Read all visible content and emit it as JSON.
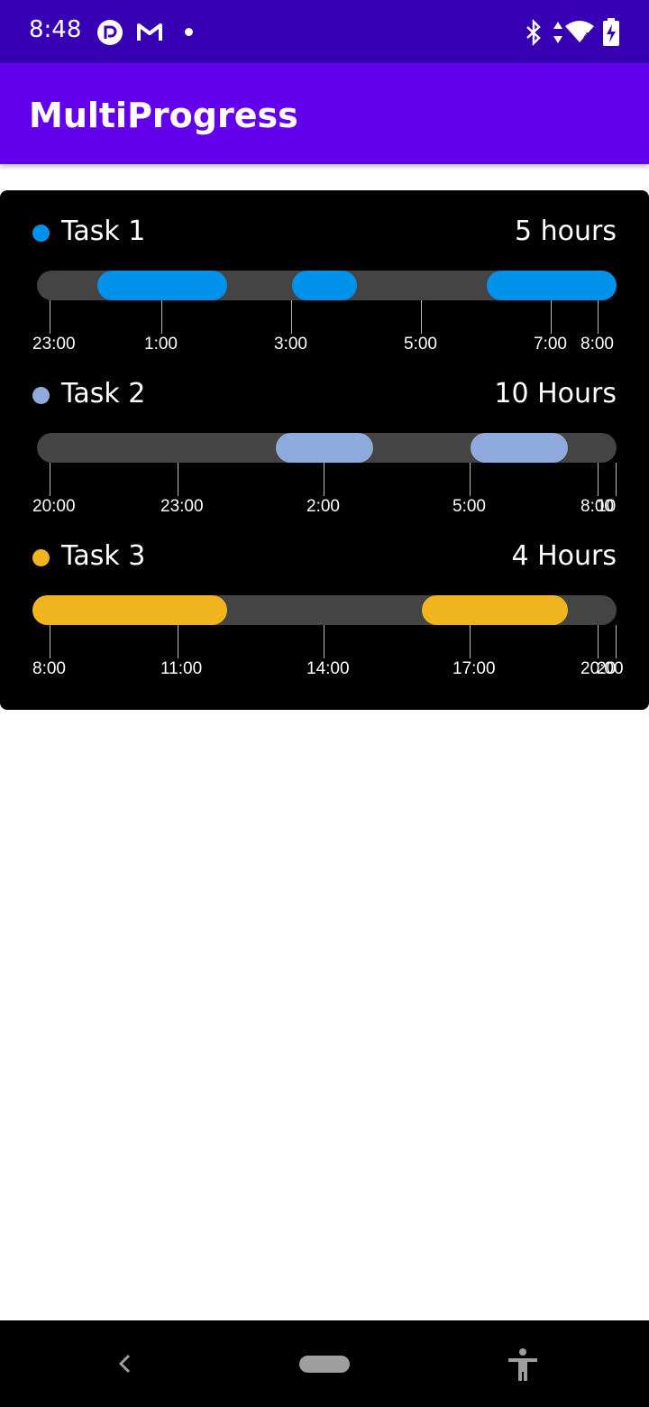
{
  "status_bar": {
    "time": "8:48",
    "notification_icons": [
      "pocket-casts-icon",
      "gmail-icon",
      "dot-icon"
    ],
    "system_icons": [
      "bluetooth-icon",
      "data-arrows-icon",
      "wifi-icon",
      "battery-charging-icon"
    ]
  },
  "app_bar": {
    "title": "MultiProgress"
  },
  "tasks": [
    {
      "name": "Task 1",
      "duration": "5 hours",
      "color": "#0091EA",
      "progress_segments": [
        [
          0.105,
          0.328
        ],
        [
          0.44,
          0.552
        ],
        [
          0.776,
          1.0
        ]
      ],
      "tick_labels": [
        "23:00",
        "1:00",
        "3:00",
        "5:00",
        "7:00",
        "8:00"
      ],
      "tick_positions": [
        0.0,
        0.222,
        0.446,
        0.67,
        0.894,
        0.975
      ]
    },
    {
      "name": "Task 2",
      "duration": "10 Hours",
      "color": "#8FAADC",
      "progress_segments": [
        [
          0.412,
          0.58
        ],
        [
          0.75,
          0.917
        ]
      ],
      "tick_labels": [
        "20:00",
        "23:00",
        "2:00",
        "5:00",
        "8:00",
        "10:00"
      ],
      "tick_positions": [
        0.0,
        0.221,
        0.473,
        0.725,
        0.975,
        1.0
      ]
    },
    {
      "name": "Task 3",
      "duration": "4 Hours",
      "color": "#F0B41E",
      "progress_segments": [
        [
          0.0,
          0.328
        ],
        [
          0.664,
          0.916
        ]
      ],
      "tick_labels": [
        "8:00",
        "11:00",
        "14:00",
        "17:00",
        "20:00",
        "20:00"
      ],
      "tick_positions": [
        0.0,
        0.221,
        0.473,
        0.725,
        0.975,
        1.0
      ]
    }
  ],
  "nav_bar": {
    "icons": [
      "back-icon",
      "home-pill-icon",
      "accessibility-icon"
    ]
  }
}
